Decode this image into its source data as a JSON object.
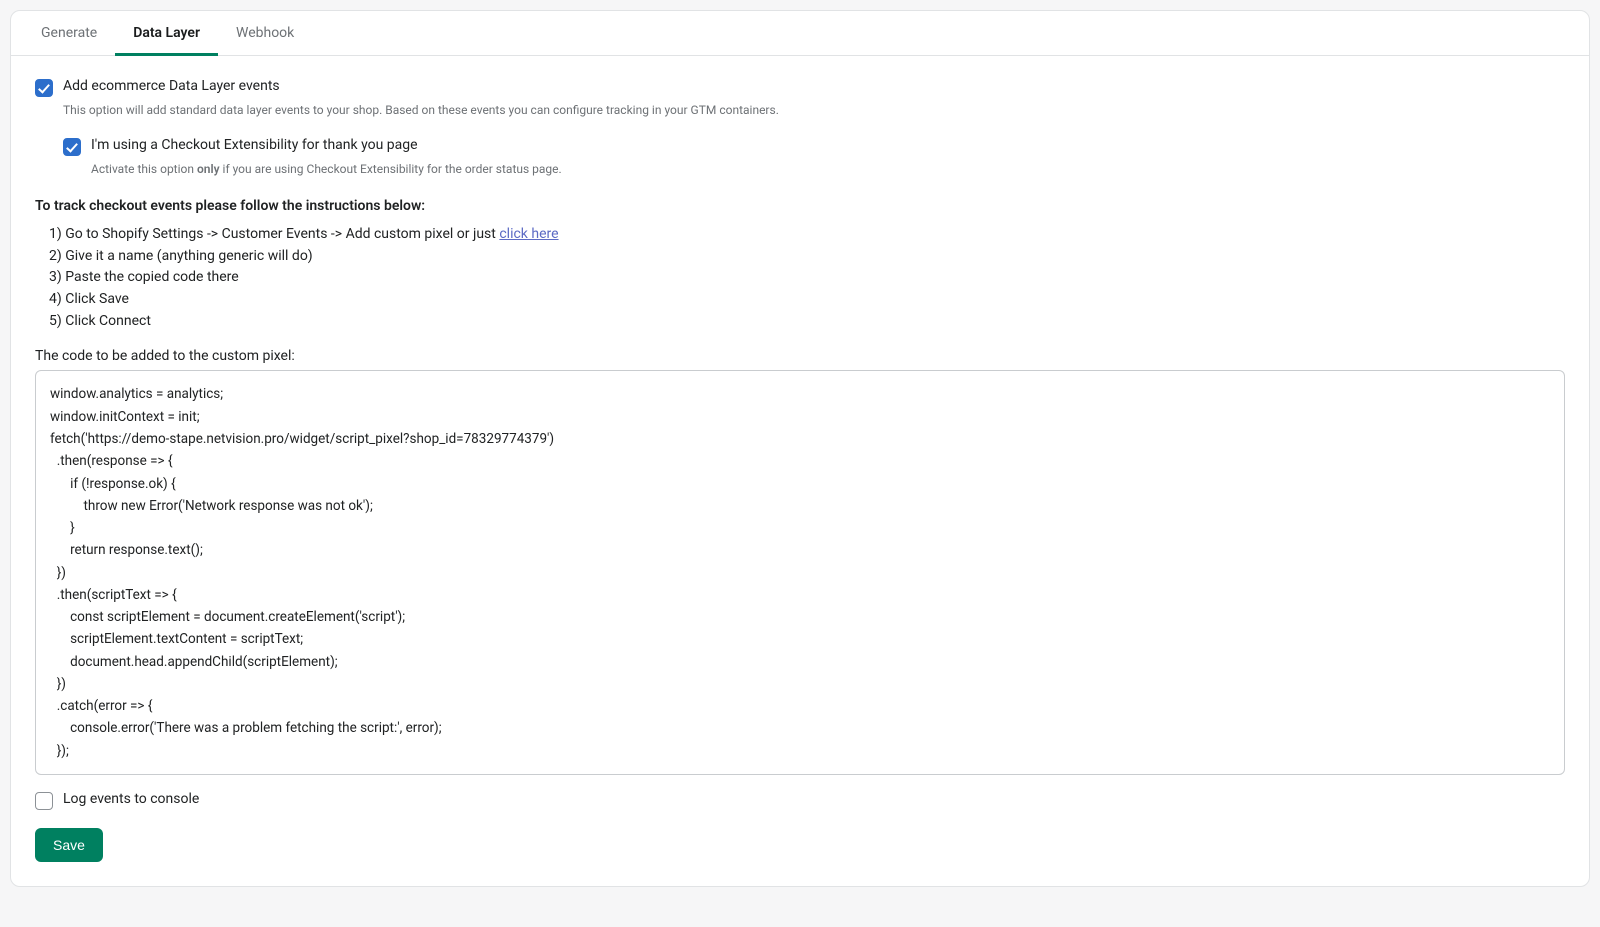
{
  "tabs": {
    "generate": "Generate",
    "dataLayer": "Data Layer",
    "webhook": "Webhook"
  },
  "addEvents": {
    "label": "Add ecommerce Data Layer events",
    "help": "This option will add standard data layer events to your shop. Based on these events you can configure tracking in your GTM containers.",
    "checked": true
  },
  "checkoutExt": {
    "label": "I'm using a Checkout Extensibility for thank you page",
    "help_prefix": "Activate this option ",
    "help_only": "only",
    "help_suffix": " if you are using Checkout Extensibility for the order status page.",
    "checked": true
  },
  "instructionsHeading": "To track checkout events please follow the instructions below:",
  "instructions": {
    "step1_prefix": "1) Go to Shopify Settings -> Customer Events -> Add custom pixel or just ",
    "step1_link": "click here",
    "step2": "2) Give it a name (anything generic will do)",
    "step3": "3) Paste the copied code there",
    "step4": "4) Click Save",
    "step5": "5) Click Connect"
  },
  "codeLabel": "The code to be added to the custom pixel:",
  "code": "window.analytics = analytics;\nwindow.initContext = init;\nfetch('https://demo-stape.netvision.pro/widget/script_pixel?shop_id=78329774379')\n  .then(response => {\n      if (!response.ok) {\n          throw new Error('Network response was not ok');\n      }\n      return response.text();\n  })\n  .then(scriptText => {\n      const scriptElement = document.createElement('script');\n      scriptElement.textContent = scriptText;\n      document.head.appendChild(scriptElement);\n  })\n  .catch(error => {\n      console.error('There was a problem fetching the script:', error);\n  });",
  "logEvents": {
    "label": "Log events to console",
    "checked": false
  },
  "saveButton": "Save"
}
